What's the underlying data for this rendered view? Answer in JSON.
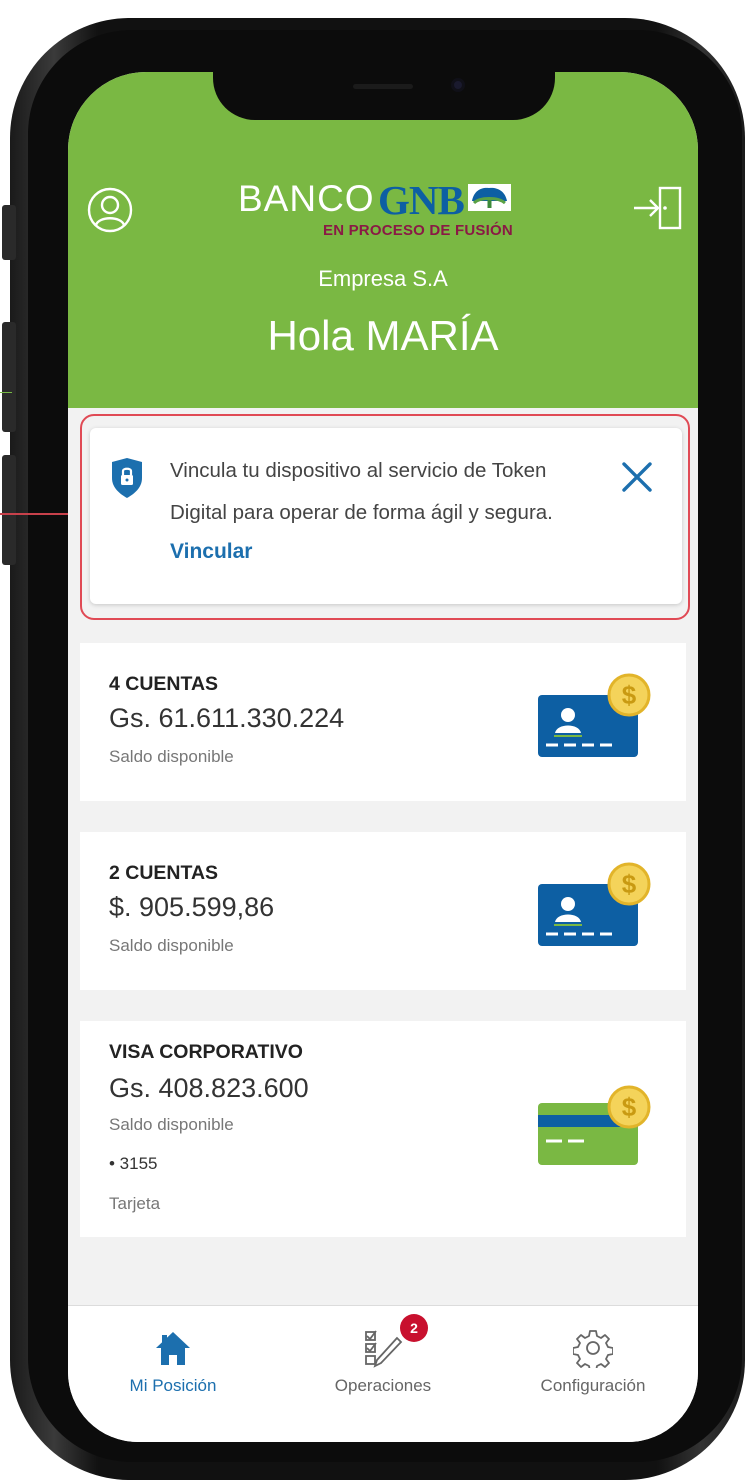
{
  "header": {
    "logo_text_banco": "BANCO",
    "logo_text_gnb": "GNB",
    "logo_subtitle": "EN PROCESO DE FUSIÓN",
    "company": "Empresa S.A",
    "greeting": "Hola MARÍA",
    "profile_icon": "user-circle-icon",
    "logout_icon": "logout-door-icon"
  },
  "token_banner": {
    "message": "Vincula tu dispositivo al servicio de Token Digital para operar de forma ágil y segura.",
    "link_label": "Vincular",
    "icon": "shield-lock-icon",
    "close_icon": "close-icon"
  },
  "accounts": [
    {
      "title": "4 CUENTAS",
      "amount": "Gs. 61.611.330.224",
      "subtitle": "Saldo disponible",
      "icon": "account-card-icon"
    },
    {
      "title": "2 CUENTAS",
      "amount": "$. 905.599,86",
      "subtitle": "Saldo disponible",
      "icon": "account-card-icon"
    },
    {
      "title": "VISA CORPORATIVO",
      "amount": "Gs. 408.823.600",
      "subtitle": "Saldo disponible",
      "card_number": "• 3155",
      "card_label": "Tarjeta",
      "icon": "credit-card-icon"
    }
  ],
  "nav": [
    {
      "label": "Mi Posición",
      "icon": "home-icon",
      "active": true
    },
    {
      "label": "Operaciones",
      "icon": "operations-checklist-icon",
      "badge": "2"
    },
    {
      "label": "Configuración",
      "icon": "gear-icon"
    }
  ],
  "colors": {
    "header_green": "#7ab843",
    "link_blue": "#1c6fae",
    "brand_blue": "#0d5fa3",
    "highlight_red": "#e04a55",
    "badge_red": "#c8102e",
    "coin_gold": "#e2b42a"
  }
}
